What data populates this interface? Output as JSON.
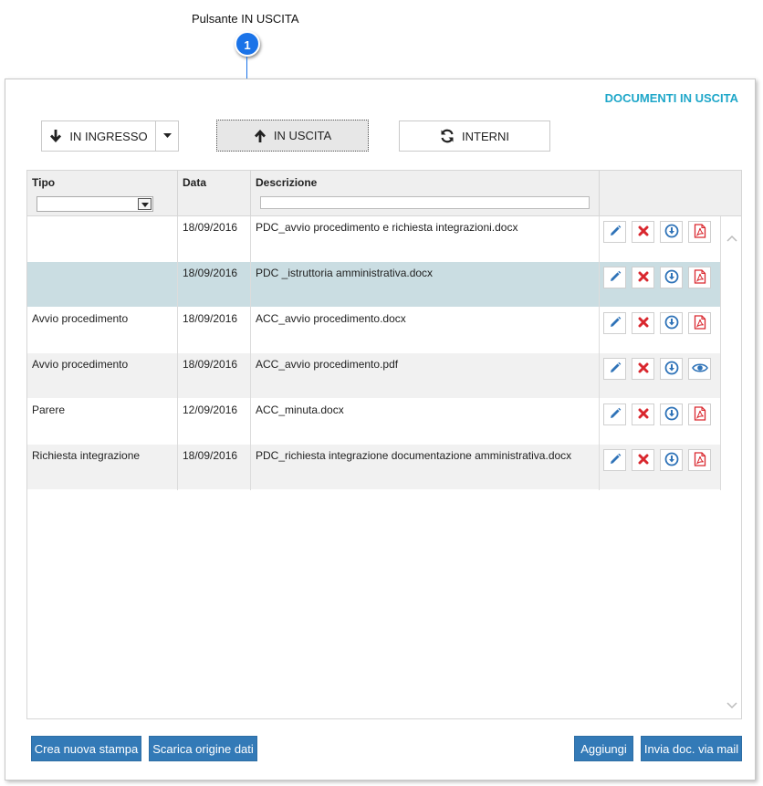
{
  "callout": {
    "label": "Pulsante IN USCITA",
    "number": "1"
  },
  "panel": {
    "title": "DOCUMENTI IN USCITA"
  },
  "toolbar": {
    "in_ingresso": "IN INGRESSO",
    "in_uscita": "IN USCITA",
    "interni": "INTERNI"
  },
  "grid": {
    "headers": {
      "tipo": "Tipo",
      "data": "Data",
      "descrizione": "Descrizione"
    },
    "rows": [
      {
        "tipo": "",
        "data": "18/09/2016",
        "descrizione": "PDC_avvio procedimento e richiesta integrazioni.docx",
        "last_action": "pdf-icon"
      },
      {
        "tipo": "",
        "data": "18/09/2016",
        "descrizione": "PDC _istruttoria amministrativa.docx",
        "last_action": "pdf-icon",
        "selected": true
      },
      {
        "tipo": "Avvio procedimento",
        "data": "18/09/2016",
        "descrizione": "ACC_avvio procedimento.docx",
        "last_action": "pdf-icon"
      },
      {
        "tipo": "Avvio procedimento",
        "data": "18/09/2016",
        "descrizione": "ACC_avvio procedimento.pdf",
        "last_action": "eye-icon"
      },
      {
        "tipo": "Parere",
        "data": "12/09/2016",
        "descrizione": "ACC_minuta.docx",
        "last_action": "pdf-icon"
      },
      {
        "tipo": "Richiesta integrazione",
        "data": "18/09/2016",
        "descrizione": "PDC_richiesta integrazione documentazione amministrativa.docx",
        "last_action": "pdf-icon"
      }
    ]
  },
  "footer": {
    "crea": "Crea nuova stampa",
    "scarica": "Scarica origine dati",
    "aggiungi": "Aggiungi",
    "invia": "Invia doc. via mail"
  },
  "colors": {
    "accent": "#1fa7c9",
    "primary_button": "#337ab7",
    "selected_row": "#cadde2",
    "callout": "#1a73e8"
  }
}
